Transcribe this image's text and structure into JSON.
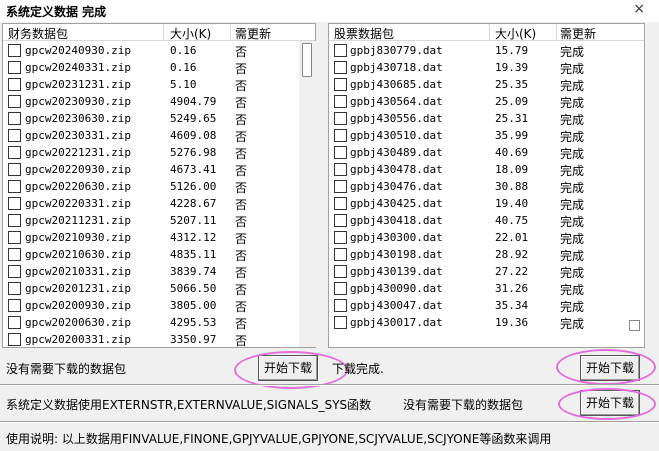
{
  "window": {
    "title": "系统定义数据 完成",
    "close_glyph": "×"
  },
  "left_panel": {
    "headers": {
      "name": "财务数据包",
      "size": "大小(K)",
      "status": "需更新"
    },
    "rows": [
      {
        "name": "gpcw20240930.zip",
        "size": "0.16",
        "status": "否"
      },
      {
        "name": "gpcw20240331.zip",
        "size": "0.16",
        "status": "否"
      },
      {
        "name": "gpcw20231231.zip",
        "size": "5.10",
        "status": "否"
      },
      {
        "name": "gpcw20230930.zip",
        "size": "4904.79",
        "status": "否"
      },
      {
        "name": "gpcw20230630.zip",
        "size": "5249.65",
        "status": "否"
      },
      {
        "name": "gpcw20230331.zip",
        "size": "4609.08",
        "status": "否"
      },
      {
        "name": "gpcw20221231.zip",
        "size": "5276.98",
        "status": "否"
      },
      {
        "name": "gpcw20220930.zip",
        "size": "4673.41",
        "status": "否"
      },
      {
        "name": "gpcw20220630.zip",
        "size": "5126.00",
        "status": "否"
      },
      {
        "name": "gpcw20220331.zip",
        "size": "4228.67",
        "status": "否"
      },
      {
        "name": "gpcw20211231.zip",
        "size": "5207.11",
        "status": "否"
      },
      {
        "name": "gpcw20210930.zip",
        "size": "4312.12",
        "status": "否"
      },
      {
        "name": "gpcw20210630.zip",
        "size": "4835.11",
        "status": "否"
      },
      {
        "name": "gpcw20210331.zip",
        "size": "3839.74",
        "status": "否"
      },
      {
        "name": "gpcw20201231.zip",
        "size": "5066.50",
        "status": "否"
      },
      {
        "name": "gpcw20200930.zip",
        "size": "3805.00",
        "status": "否"
      },
      {
        "name": "gpcw20200630.zip",
        "size": "4295.53",
        "status": "否"
      },
      {
        "name": "gpcw20200331.zip",
        "size": "3350.97",
        "status": "否"
      }
    ],
    "status_text": "没有需要下载的数据包",
    "button": "开始下载"
  },
  "right_panel": {
    "headers": {
      "name": "股票数据包",
      "size": "大小(K)",
      "status": "需更新"
    },
    "rows": [
      {
        "name": "gpbj830779.dat",
        "size": "15.79",
        "status": "完成"
      },
      {
        "name": "gpbj430718.dat",
        "size": "19.39",
        "status": "完成"
      },
      {
        "name": "gpbj430685.dat",
        "size": "25.35",
        "status": "完成"
      },
      {
        "name": "gpbj430564.dat",
        "size": "25.09",
        "status": "完成"
      },
      {
        "name": "gpbj430556.dat",
        "size": "25.31",
        "status": "完成"
      },
      {
        "name": "gpbj430510.dat",
        "size": "35.99",
        "status": "完成"
      },
      {
        "name": "gpbj430489.dat",
        "size": "40.69",
        "status": "完成"
      },
      {
        "name": "gpbj430478.dat",
        "size": "18.09",
        "status": "完成"
      },
      {
        "name": "gpbj430476.dat",
        "size": "30.88",
        "status": "完成"
      },
      {
        "name": "gpbj430425.dat",
        "size": "19.40",
        "status": "完成"
      },
      {
        "name": "gpbj430418.dat",
        "size": "40.75",
        "status": "完成"
      },
      {
        "name": "gpbj430300.dat",
        "size": "22.01",
        "status": "完成"
      },
      {
        "name": "gpbj430198.dat",
        "size": "28.92",
        "status": "完成"
      },
      {
        "name": "gpbj430139.dat",
        "size": "27.22",
        "status": "完成"
      },
      {
        "name": "gpbj430090.dat",
        "size": "31.26",
        "status": "完成"
      },
      {
        "name": "gpbj430047.dat",
        "size": "35.34",
        "status": "完成"
      },
      {
        "name": "gpbj430017.dat",
        "size": "19.36",
        "status": "完成"
      }
    ],
    "status_text": "下载完成.",
    "button": "开始下载"
  },
  "system_section": {
    "label": "系统定义数据使用EXTERNSTR,EXTERNVALUE,SIGNALS_SYS函数",
    "status_text": "没有需要下载的数据包",
    "button": "开始下载"
  },
  "usage_note": "使用说明: 以上数据用FINVALUE,FINONE,GPJYVALUE,GPJYONE,SCJYVALUE,SCJYONE等函数来调用",
  "colors": {
    "highlight_ellipse": "#e070d8",
    "background": "#f0f0f0"
  }
}
